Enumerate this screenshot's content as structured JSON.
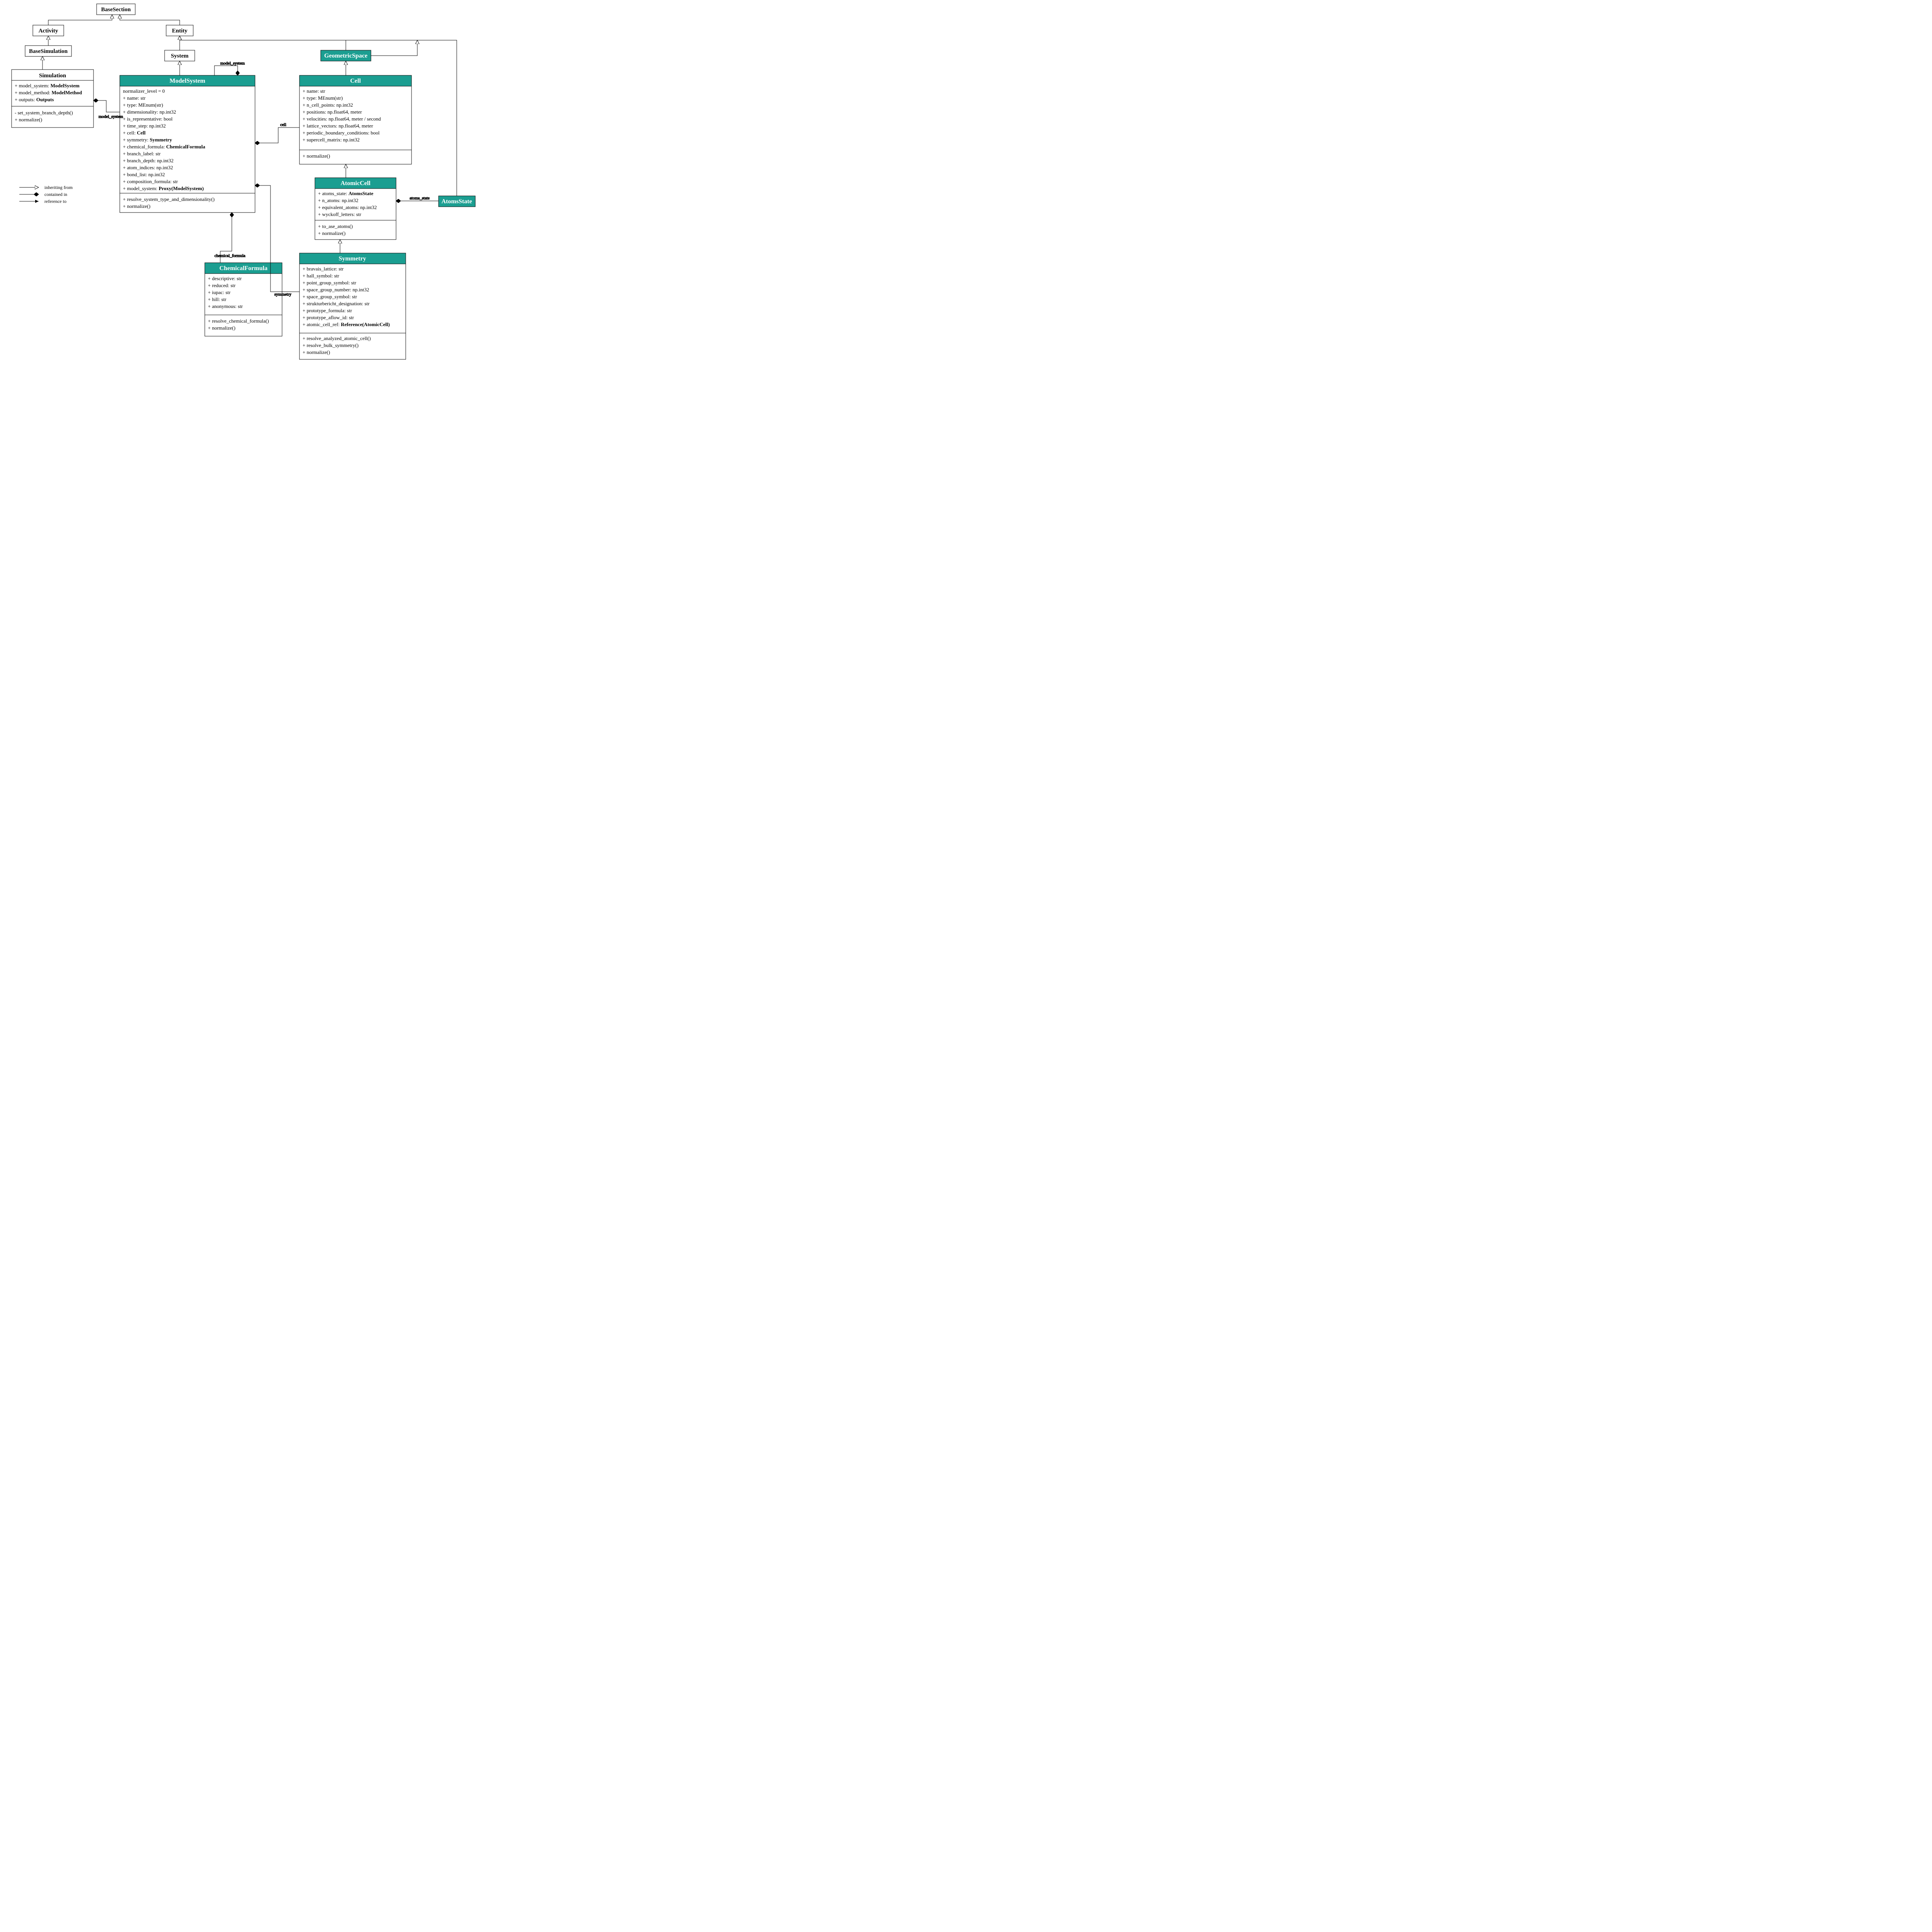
{
  "colors": {
    "teal": "#1b9e91",
    "stroke": "#000"
  },
  "boxes": {
    "BaseSection": {
      "title": "BaseSection"
    },
    "Activity": {
      "title": "Activity"
    },
    "BaseSimulation": {
      "title": "BaseSimulation"
    },
    "Entity": {
      "title": "Entity"
    },
    "System": {
      "title": "System"
    },
    "GeometricSpace": {
      "title": "GeometricSpace"
    },
    "AtomsState": {
      "title": "AtomsState"
    },
    "Simulation": {
      "title": "Simulation",
      "attrs": [
        "+ model_system:",
        "+ model_method:",
        "+ outputs:"
      ],
      "attrs_b": [
        "ModelSystem",
        "ModelMethod",
        "Outputs"
      ],
      "ops": [
        "- set_system_branch_depth()",
        "+ normalize()"
      ]
    },
    "ModelSystem": {
      "title": "ModelSystem",
      "attrs": [
        {
          "t": "normalizer_level = 0"
        },
        {
          "t": "+ name: str"
        },
        {
          "t": "+ type: MEnum(str)"
        },
        {
          "t": "+ dimensionality: np.int32"
        },
        {
          "t": "+ is_representative: bool"
        },
        {
          "t": "+ time_step: np.int32"
        },
        {
          "t": "+ cell: ",
          "b": "Cell"
        },
        {
          "t": "+ symmetry: ",
          "b": "Symmetry"
        },
        {
          "t": "+ chemical_formula: ",
          "b": "ChemicalFormula"
        },
        {
          "t": "+ branch_label: str"
        },
        {
          "t": "+ branch_depth: np.int32"
        },
        {
          "t": "+ atom_indices: np.int32"
        },
        {
          "t": "+ bond_list: np.int32"
        },
        {
          "t": "+ composition_formula: str"
        },
        {
          "t": "+ model_system: ",
          "b": "Proxy(ModelSystem)"
        }
      ],
      "ops": [
        "+ resolve_system_type_and_dimensionality()",
        "+ normalize()"
      ]
    },
    "Cell": {
      "title": "Cell",
      "attrs": [
        "+ name: str",
        "+ type: MEnum(str)",
        "+ n_cell_points: np.int32",
        "+ positions: np.float64, meter",
        "+ velocities: np.float64, meter / second",
        "+ lattice_vectors: np.float64, meter",
        "+ periodic_boundary_conditions: bool",
        "+ supercell_matrix: np.int32"
      ],
      "ops": [
        "+ normalize()"
      ]
    },
    "AtomicCell": {
      "title": "AtomicCell",
      "attrs": [
        {
          "t": "+ atoms_state: ",
          "b": "AtomsState"
        },
        {
          "t": "+ n_atoms: np.int32"
        },
        {
          "t": "+ equivalent_atoms: np.int32"
        },
        {
          "t": "+ wyckoff_letters: str"
        }
      ],
      "ops": [
        "+ to_ase_atoms()",
        "+ normalize()"
      ]
    },
    "ChemicalFormula": {
      "title": "ChemicalFormula",
      "attrs": [
        "+ descriptive: str",
        "+ reduced: str",
        "+ iupac: str",
        "+ hill: str",
        "+ anonymous: str"
      ],
      "ops": [
        "+ resolve_chemical_formula()",
        "+ normalize()"
      ]
    },
    "Symmetry": {
      "title": "Symmetry",
      "attrs": [
        {
          "t": "+ bravais_lattice: str"
        },
        {
          "t": "+ hall_symbol: str"
        },
        {
          "t": "+ point_group_symbol: str"
        },
        {
          "t": "+ space_group_number: np.int32"
        },
        {
          "t": "+ space_group_symbol: str"
        },
        {
          "t": "+ strukturbericht_designation: str"
        },
        {
          "t": "+ prototype_formula: str"
        },
        {
          "t": "+ prototype_aflow_id: str"
        },
        {
          "t": "+ atomic_cell_ref: ",
          "b": "Reference(AtomicCell)"
        }
      ],
      "ops": [
        "+ resolve_analyzed_atomic_cell()",
        "+ resolve_bulk_symmetry()",
        "+ normalize()"
      ]
    }
  },
  "edge_labels": {
    "model_system_self": "model_system",
    "model_system_sim": "model_system",
    "cell": "cell",
    "chemical_formula": "chemical_formula",
    "symmetry": "symmetry",
    "atoms_state": "atoms_state"
  },
  "legend": {
    "inherit": "inheriting from",
    "contained": "contained in",
    "reference": "reference to"
  }
}
